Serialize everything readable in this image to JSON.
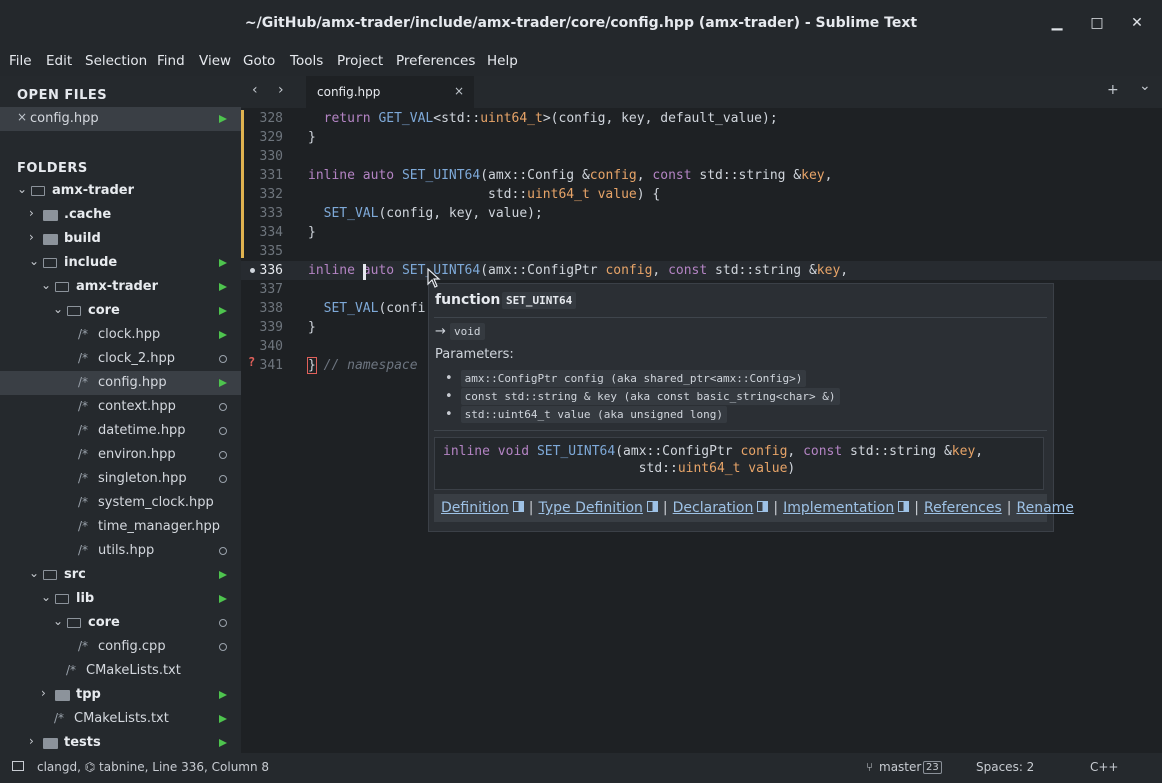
{
  "window": {
    "title": "~/GitHub/amx-trader/include/amx-trader/core/config.hpp (amx-trader) - Sublime Text",
    "minimize": "▁",
    "maximize": "□",
    "close": "✕"
  },
  "menu": [
    "File",
    "Edit",
    "Selection",
    "Find",
    "View",
    "Goto",
    "Tools",
    "Project",
    "Preferences",
    "Help"
  ],
  "sidebar": {
    "open_files_header": "OPEN FILES",
    "open_file": "config.hpp",
    "folders_header": "FOLDERS",
    "tree": [
      {
        "label": "amx-trader",
        "kind": "folder-open",
        "depth": 0
      },
      {
        "label": ".cache",
        "kind": "folder",
        "depth": 1
      },
      {
        "label": "build",
        "kind": "folder",
        "depth": 1
      },
      {
        "label": "include",
        "kind": "folder-open",
        "depth": 1,
        "mark": "green"
      },
      {
        "label": "amx-trader",
        "kind": "folder-open",
        "depth": 2,
        "mark": "green"
      },
      {
        "label": "core",
        "kind": "folder-open",
        "depth": 3,
        "mark": "green"
      },
      {
        "label": "clock.hpp",
        "kind": "file",
        "depth": 4,
        "mark": "green"
      },
      {
        "label": "clock_2.hpp",
        "kind": "file",
        "depth": 4,
        "mark": "circle"
      },
      {
        "label": "config.hpp",
        "kind": "file",
        "depth": 4,
        "mark": "green",
        "selected": true
      },
      {
        "label": "context.hpp",
        "kind": "file",
        "depth": 4,
        "mark": "circle"
      },
      {
        "label": "datetime.hpp",
        "kind": "file",
        "depth": 4,
        "mark": "circle"
      },
      {
        "label": "environ.hpp",
        "kind": "file",
        "depth": 4,
        "mark": "circle"
      },
      {
        "label": "singleton.hpp",
        "kind": "file",
        "depth": 4,
        "mark": "circle"
      },
      {
        "label": "system_clock.hpp",
        "kind": "file",
        "depth": 4
      },
      {
        "label": "time_manager.hpp",
        "kind": "file",
        "depth": 4
      },
      {
        "label": "utils.hpp",
        "kind": "file",
        "depth": 4,
        "mark": "circle"
      },
      {
        "label": "src",
        "kind": "folder-open",
        "depth": 1,
        "mark": "green"
      },
      {
        "label": "lib",
        "kind": "folder-open",
        "depth": 2,
        "mark": "green"
      },
      {
        "label": "core",
        "kind": "folder-open",
        "depth": 3,
        "mark": "circle"
      },
      {
        "label": "config.cpp",
        "kind": "file",
        "depth": 4,
        "mark": "circle"
      },
      {
        "label": "CMakeLists.txt",
        "kind": "file",
        "depth": 3
      },
      {
        "label": "tpp",
        "kind": "folder",
        "depth": 2,
        "mark": "green"
      },
      {
        "label": "CMakeLists.txt",
        "kind": "file",
        "depth": 2,
        "mark": "green"
      },
      {
        "label": "tests",
        "kind": "folder",
        "depth": 1,
        "mark": "green"
      }
    ]
  },
  "tabs": {
    "active": "config.hpp",
    "close": "×",
    "back": "‹",
    "forward": "›",
    "new_tab": "+",
    "tab_list": "⌄"
  },
  "editor": {
    "line_numbers": [
      "328",
      "329",
      "330",
      "331",
      "332",
      "333",
      "334",
      "335",
      "336",
      "337",
      "338",
      "339",
      "340",
      "341"
    ],
    "current_line": "336"
  },
  "hover": {
    "kind": "function",
    "name": "SET_UINT64",
    "return_arrow": "→",
    "return_type": "void",
    "params_label": "Parameters:",
    "params": [
      "amx::ConfigPtr config (aka shared_ptr<amx::Config>)",
      "const std::string & key (aka const basic_string<char> &)",
      "std::uint64_t value (aka unsigned long)"
    ],
    "links": [
      "Definition",
      "Type Definition",
      "Declaration",
      "Implementation",
      "References",
      "Rename"
    ]
  },
  "status": {
    "left": "clangd, ⌬ tabnine, Line 336, Column 8",
    "branch": "master",
    "branch_count": "23",
    "indent": "Spaces: 2",
    "syntax": "C++"
  }
}
